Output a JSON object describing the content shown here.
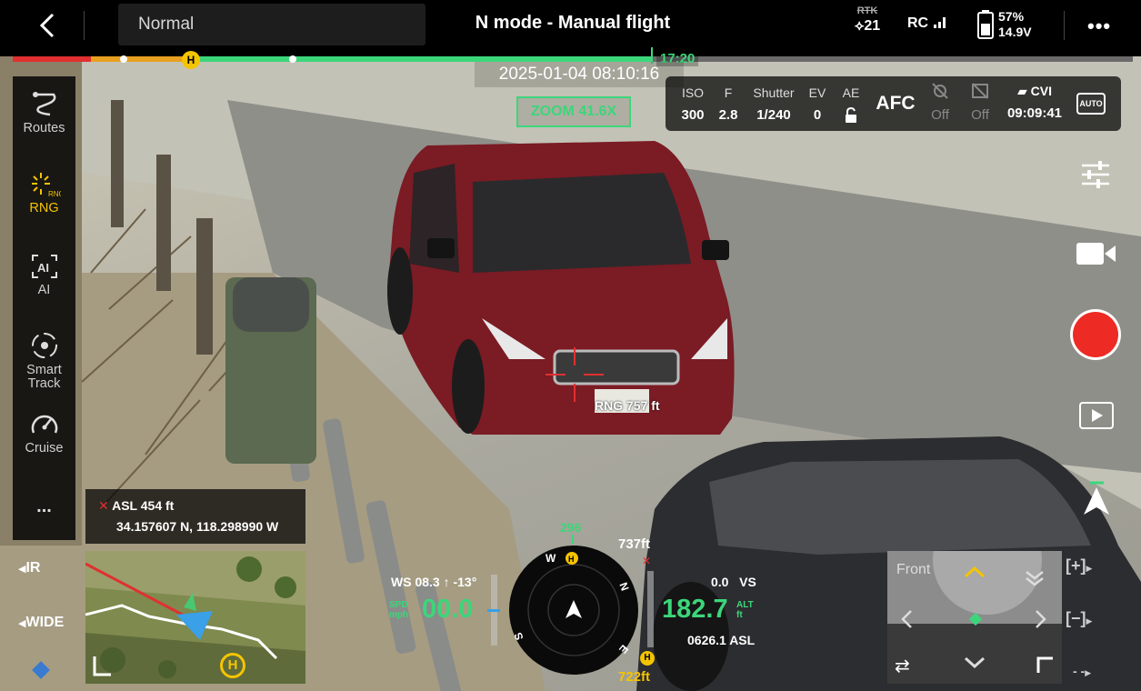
{
  "topbar": {
    "back_icon": "chevron-left-icon",
    "mode": "Normal",
    "title": "N mode - Manual flight",
    "rtk_label": "RTK",
    "satellite_count": "21",
    "rc_label": "RC",
    "battery_percent": "57%",
    "battery_voltage": "14.9V",
    "more_icon": "more-icon"
  },
  "flight_progress": {
    "time_remaining": "17:20",
    "home_marker": "H",
    "progress_fraction": 0.57
  },
  "overlay": {
    "timestamp": "2025-01-04 08:10:16",
    "zoom": "ZOOM  41.6X",
    "rng": "RNG 757 ft"
  },
  "camera_panel": {
    "iso_label": "ISO",
    "iso_value": "300",
    "f_label": "F",
    "f_value": "2.8",
    "shutter_label": "Shutter",
    "shutter_value": "1/240",
    "ev_label": "EV",
    "ev_value": "0",
    "ae_label": "AE",
    "focus_mode": "AFC",
    "setting1_value": "Off",
    "setting2_value": "Off",
    "storage_label": "CVI",
    "record_time": "09:09:41",
    "auto_label": "AUTO"
  },
  "left_rail": {
    "items": [
      {
        "label": "Routes",
        "icon": "routes-icon"
      },
      {
        "label": "RNG",
        "icon": "rng-icon"
      },
      {
        "label": "AI",
        "icon": "ai-icon"
      },
      {
        "label": "Smart\nTrack",
        "icon": "smart-track-icon"
      },
      {
        "label": "Cruise",
        "icon": "cruise-icon"
      },
      {
        "label": "...",
        "icon": "more-icon"
      }
    ],
    "active": "RNG"
  },
  "gps": {
    "asl": "ASL 454 ft",
    "coords": "34.157607 N, 118.298990 W"
  },
  "side_labels": {
    "ir": "IR",
    "wide": "WIDE"
  },
  "telemetry": {
    "wind_speed": "WS 08.3",
    "wind_dir": "-13°",
    "speed_unit_top": "SPD",
    "speed_unit_bottom": "mph",
    "speed": "00.0",
    "heading": "296",
    "compass_letters": [
      "N",
      "E",
      "S",
      "W"
    ],
    "home_label": "H",
    "dist_top": "737ft",
    "dist_bottom": "722ft",
    "vs": "0.0",
    "vs_label": "VS",
    "altitude": "182.7",
    "alt_unit_top": "ALT",
    "alt_unit_bottom": "ft",
    "asl": "0626.1 ASL"
  },
  "gimbal": {
    "title": "Front"
  },
  "zoom_controls": {
    "plus": "[+]",
    "minus": "[−]",
    "dash": "- -"
  },
  "colors": {
    "accent_green": "#3cd67a",
    "warning_yellow": "#f5c400",
    "record_red": "#ee2a24",
    "alert_red": "#e03030"
  }
}
